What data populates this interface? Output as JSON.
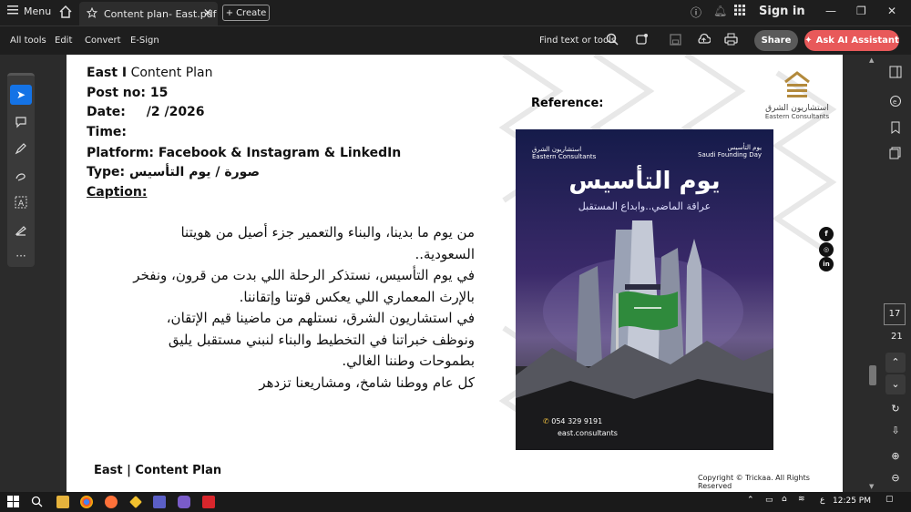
{
  "titlebar": {
    "menu_label": "Menu",
    "tab_title": "Content plan- East.pdf",
    "create_label": "Create",
    "sign_in": "Sign in"
  },
  "toolbar": {
    "items": [
      "All tools",
      "Edit",
      "Convert",
      "E-Sign"
    ],
    "find_label": "Find text or tools",
    "share_label": "Share",
    "ai_label": "Ask AI Assistant"
  },
  "document": {
    "company_line_bold": "East I",
    "company_line_rest": " Content Plan",
    "post_no": "Post no: 15",
    "date_label": "Date:",
    "date_value": "/2 /2026",
    "time_label": "Time:",
    "platform": "Platform: Facebook & Instagram & LinkedIn",
    "type_label": "Type:",
    "type_value": "صورة / يوم التأسيس",
    "caption_label": "Caption:",
    "caption_lines": [
      "من يوم ما بدينا، والبناء والتعمير جزء أصيل من هويتنا",
      "السعودية..",
      "في يوم التأسيس، نستذكر الرحلة اللي بدت من قرون، ونفخر",
      "بالإرث المعماري اللي يعكس قوتنا وإتقاننا.",
      "في استشاريون الشرق، نستلهم من ماضينا قيم الإتقان،",
      "ونوظف خبراتنا في التخطيط والبناء لنبني مستقبل يليق",
      "بطموحات وطننا الغالي.",
      "كل عام ووطنا شامخ، ومشاريعنا تزدهر"
    ],
    "reference_label": "Reference:",
    "logo_ar": "استشاريون الشرق",
    "logo_en": "Eastern Consultants",
    "poster": {
      "logo_ar": "استشاريون الشرق",
      "logo_en": "Eastern Consultants",
      "badge_ar": "يوم التأسيس",
      "badge_en": "Saudi Founding Day",
      "title": "يوم التأسيس",
      "subtitle": "عراقة الماضي..وابداع المستقبل",
      "phone": "054 329 9191",
      "site": "east.consultants"
    },
    "social_icons": [
      "f",
      "ig",
      "in"
    ],
    "footer_left": "East | Content Plan",
    "footer_right": "Copyright © Trickaa. All Rights Reserved"
  },
  "nav": {
    "current_page": "17",
    "total_pages": "21"
  },
  "taskbar": {
    "lang": "ع",
    "time": "12:25 PM"
  },
  "colors": {
    "accent": "#1473e6",
    "ai_button": "#e8595a",
    "brand_gold": "#b38a3c"
  }
}
